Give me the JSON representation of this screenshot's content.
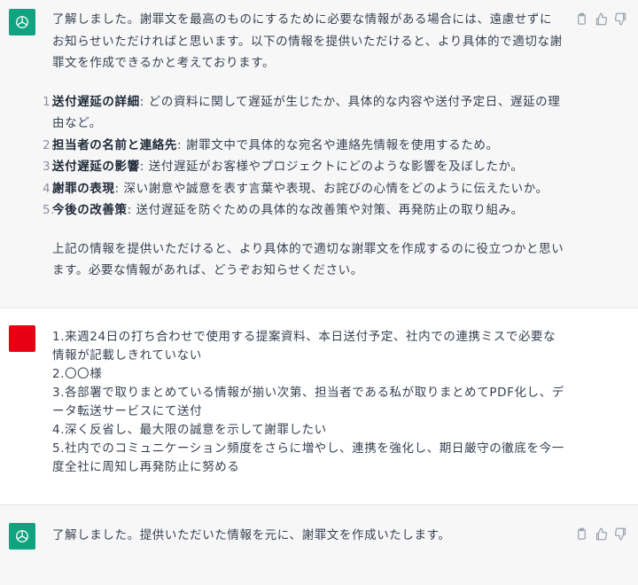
{
  "messages": [
    {
      "role": "assistant",
      "intro": "了解しました。謝罪文を最高のものにするために必要な情報がある場合には、遠慮せずにお知らせいただければと思います。以下の情報を提供いただけると、より具体的で適切な謝罪文を作成できるかと考えております。",
      "list": [
        {
          "num": "1.",
          "title": "送付遅延の詳細",
          "text": ": どの資料に関して遅延が生じたか、具体的な内容や送付予定日、遅延の理由など。"
        },
        {
          "num": "2.",
          "title": "担当者の名前と連絡先",
          "text": ": 謝罪文中で具体的な宛名や連絡先情報を使用するため。"
        },
        {
          "num": "3.",
          "title": "送付遅延の影響",
          "text": ": 送付遅延がお客様やプロジェクトにどのような影響を及ぼしたか。"
        },
        {
          "num": "4.",
          "title": "謝罪の表現",
          "text": ": 深い謝意や誠意を表す言葉や表現、お詫びの心情をどのように伝えたいか。"
        },
        {
          "num": "5.",
          "title": "今後の改善策",
          "text": ": 送付遅延を防ぐための具体的な改善策や対策、再発防止の取り組み。"
        }
      ],
      "outro": "上記の情報を提供いただけると、より具体的で適切な謝罪文を作成するのに役立つかと思います。必要な情報があれば、どうぞお知らせください。"
    },
    {
      "role": "user",
      "lines": [
        "1.来週24日の打ち合わせで使用する提案資料、本日送付予定、社内での連携ミスで必要な情報が記載しきれていない",
        "2.〇〇様",
        "3.各部署で取りまとめている情報が揃い次第、担当者である私が取りまとめてPDF化し、データ転送サービスにて送付",
        "4.深く反省し、最大限の誠意を示して謝罪したい",
        "5.社内でのコミュニケーション頻度をさらに増やし、連携を強化し、期日厳守の徹底を今一度全社に周知し再発防止に努める"
      ]
    },
    {
      "role": "assistant",
      "text": "了解しました。提供いただいた情報を元に、謝罪文を作成いたします。"
    }
  ],
  "icons": {
    "copy": "clipboard-icon",
    "like": "thumbs-up-icon",
    "dislike": "thumbs-down-icon",
    "avatar_assistant": "openai-logo-icon",
    "avatar_user": "user-avatar"
  },
  "colors": {
    "assistant_bg": "#f7f7f8",
    "brand_green": "#10a37f",
    "user_avatar": "#e60012"
  }
}
